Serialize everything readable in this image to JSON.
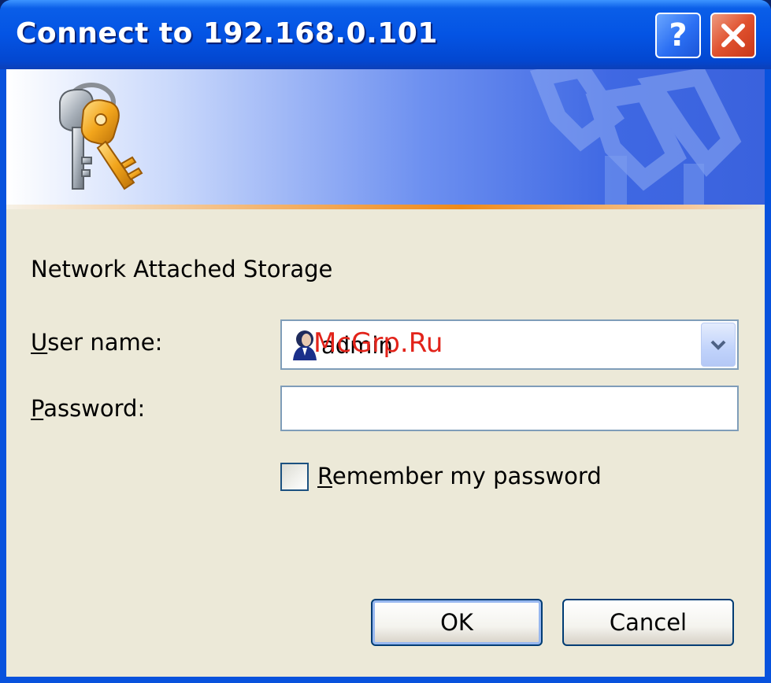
{
  "window": {
    "title": "Connect to 192.168.0.101",
    "help_button_label": "?",
    "close_icon": "close-icon"
  },
  "banner": {
    "icon": "keys-icon",
    "accent_color": "#f08a18"
  },
  "form": {
    "realm_text": "Network Attached Storage",
    "username_label_first": "U",
    "username_label_rest": "ser name:",
    "username_value": "admin",
    "username_icon": "user-icon",
    "password_label_first": "P",
    "password_label_rest": "assword:",
    "password_value": "",
    "remember_label_first": "R",
    "remember_label_rest": "emember my password",
    "remember_checked": false
  },
  "buttons": {
    "ok_label": "OK",
    "cancel_label": "Cancel"
  },
  "overlay": {
    "watermark": "McGrp.Ru",
    "watermark_color": "#e2231a"
  },
  "colors": {
    "titlebar": "#0454e4",
    "client_bg": "#ece9d8",
    "field_border": "#7f9db9"
  }
}
